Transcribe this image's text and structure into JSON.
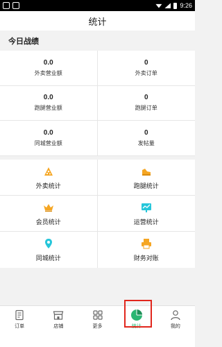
{
  "status_bar": {
    "time": "9:26"
  },
  "header": {
    "title": "统计"
  },
  "today": {
    "title": "今日战绩",
    "stats": [
      {
        "value": "0.0",
        "label": "外卖营业额"
      },
      {
        "value": "0",
        "label": "外卖订单"
      },
      {
        "value": "0.0",
        "label": "跑腿营业额"
      },
      {
        "value": "0",
        "label": "跑腿订单"
      },
      {
        "value": "0.0",
        "label": "同城营业额"
      },
      {
        "value": "0",
        "label": "发帖量"
      }
    ]
  },
  "modules": [
    {
      "label": "外卖统计",
      "icon": "pizza-icon",
      "color": "#f5a623"
    },
    {
      "label": "跑腿统计",
      "icon": "running-shoe-icon",
      "color": "#f5a623"
    },
    {
      "label": "会员统计",
      "icon": "crown-icon",
      "color": "#f5a623"
    },
    {
      "label": "运营统计",
      "icon": "chart-board-icon",
      "color": "#26c6da"
    },
    {
      "label": "同城统计",
      "icon": "location-pin-icon",
      "color": "#26c6da"
    },
    {
      "label": "财务对账",
      "icon": "printer-icon",
      "color": "#f5a623"
    }
  ],
  "tabs": [
    {
      "label": "订单",
      "icon": "order-icon"
    },
    {
      "label": "店铺",
      "icon": "store-icon"
    },
    {
      "label": "更多",
      "icon": "grid-icon"
    },
    {
      "label": "统计",
      "icon": "pie-chart-icon",
      "active": true
    },
    {
      "label": "我的",
      "icon": "profile-icon"
    }
  ],
  "colors": {
    "accent": "#2bb673",
    "highlight": "#e1261c"
  }
}
